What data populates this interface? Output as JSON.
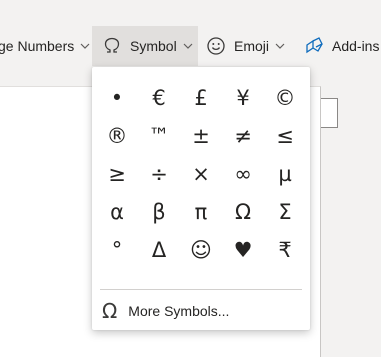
{
  "ribbon": {
    "page_numbers_label": "ge Numbers",
    "symbol_label": "Symbol",
    "emoji_label": "Emoji",
    "addins_label": "Add-ins"
  },
  "symbol_menu": {
    "symbols": [
      "•",
      "€",
      "£",
      "¥",
      "©",
      "®",
      "™",
      "±",
      "≠",
      "≤",
      "≥",
      "÷",
      "×",
      "∞",
      "µ",
      "α",
      "β",
      "π",
      "Ω",
      "Σ",
      "°",
      "Δ",
      "☺",
      "♥",
      "₹"
    ],
    "more_label": "More Symbols..."
  },
  "colors": {
    "ribbon_bg": "#f3f2f1",
    "selected_bg": "#e1dfdd",
    "addins_icon": "#0f6cbd"
  }
}
